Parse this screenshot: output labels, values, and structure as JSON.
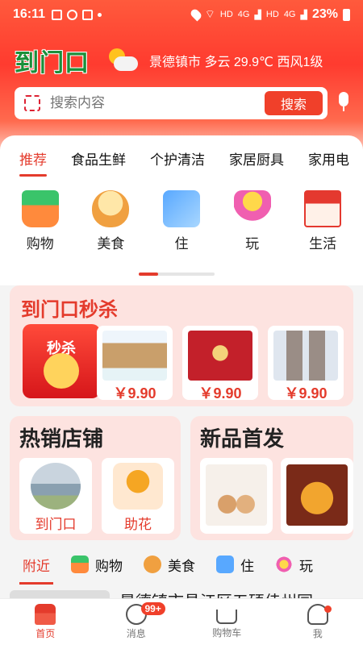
{
  "status_bar": {
    "time": "16:11",
    "network_label_1": "HD",
    "network_label_2": "HD",
    "signal_1": "4G",
    "signal_2": "4G",
    "battery": "23%"
  },
  "header": {
    "logo_text": "到门口",
    "weather": "景德镇市 多云 29.9℃ 西风1级",
    "weather_icon": "partly-cloudy-icon"
  },
  "search": {
    "placeholder": "搜索内容",
    "button_label": "搜索"
  },
  "category_tabs": [
    {
      "label": "推荐",
      "active": true
    },
    {
      "label": "食品生鲜"
    },
    {
      "label": "个护清洁"
    },
    {
      "label": "家居厨具"
    },
    {
      "label": "家用电"
    }
  ],
  "categories": [
    {
      "label": "购物",
      "icon": "shopping-basket-icon"
    },
    {
      "label": "美食",
      "icon": "noodle-bowl-icon"
    },
    {
      "label": "住",
      "icon": "card-icon"
    },
    {
      "label": "玩",
      "icon": "cocktail-icon"
    },
    {
      "label": "生活",
      "icon": "house-icon"
    }
  ],
  "category_pager_progress": 0.25,
  "flash_sale": {
    "title": "到门口秒杀",
    "banner_text": "秒杀",
    "items": [
      {
        "price": "￥9.90"
      },
      {
        "price": "￥9.90"
      },
      {
        "price": "￥9.90"
      }
    ]
  },
  "hot_stores": {
    "title": "热销店铺",
    "stores": [
      {
        "label": "到门口"
      },
      {
        "label": "助花"
      }
    ]
  },
  "new_products": {
    "title": "新品首发"
  },
  "sub_tabs": [
    {
      "label": "附近",
      "active": true
    },
    {
      "label": "购物"
    },
    {
      "label": "美食"
    },
    {
      "label": "住"
    },
    {
      "label": "玩"
    }
  ],
  "list_peek_text": "景德镇市昌江区五硕佳州园",
  "bottom_nav": [
    {
      "label": "首页",
      "icon": "home-store-icon",
      "active": true
    },
    {
      "label": "消息",
      "icon": "message-icon",
      "badge": "99+"
    },
    {
      "label": "购物车",
      "icon": "cart-icon"
    },
    {
      "label": "我",
      "icon": "profile-icon"
    }
  ],
  "colors": {
    "accent": "#e43b2c",
    "header": "#ff3b2f",
    "card_bg": "#fde3e0"
  }
}
